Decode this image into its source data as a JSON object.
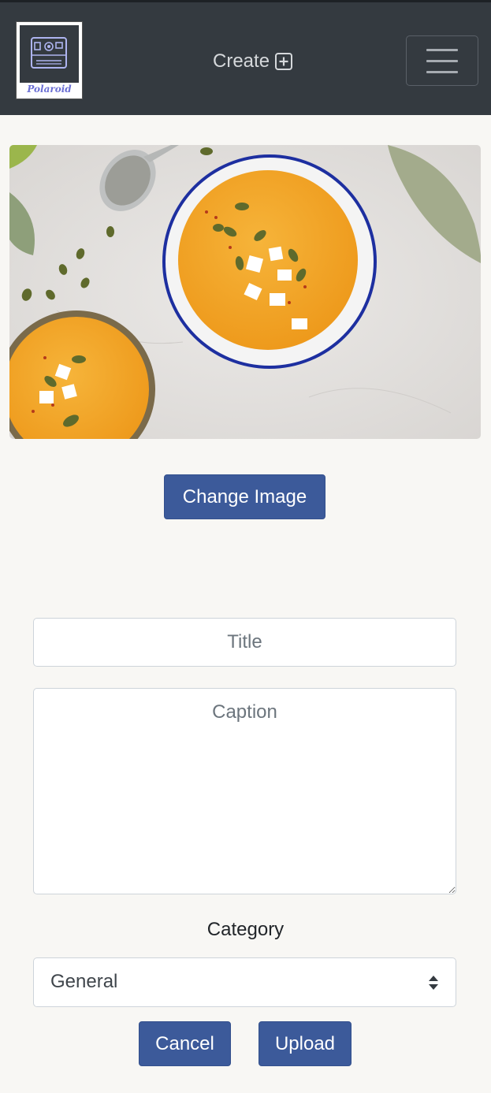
{
  "navbar": {
    "logo_text": "Polaroid",
    "create_label": "Create",
    "create_icon": "plus-square-icon",
    "menu_icon": "hamburger-menu-icon"
  },
  "hero_image": {
    "alt": "Pumpkin soup"
  },
  "buttons": {
    "change_image": "Change Image",
    "cancel": "Cancel",
    "upload": "Upload"
  },
  "form": {
    "title_placeholder": "Title",
    "caption_placeholder": "Caption",
    "category_label": "Category",
    "category_value": "General"
  },
  "colors": {
    "navbar": "#343a40",
    "primary": "#3c5a9a",
    "background": "#f8f7f4"
  }
}
